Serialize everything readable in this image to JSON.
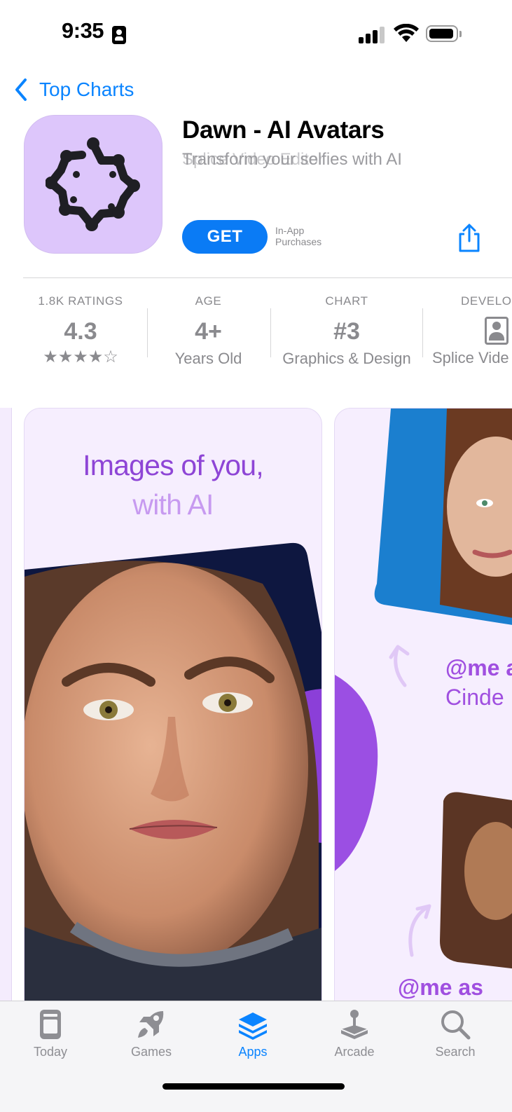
{
  "status_bar": {
    "time": "9:35"
  },
  "nav": {
    "back_label": "Top Charts"
  },
  "app": {
    "title": "Dawn - AI Avatars",
    "subtitle": "Transform your selfies with AI",
    "developer_overlap": "Splice Video Editor",
    "get_label": "GET",
    "in_app_line1": "In-App",
    "in_app_line2": "Purchases"
  },
  "info": {
    "ratings": {
      "label": "1.8K RATINGS",
      "value": "4.3",
      "stars": "★★★★☆",
      "stars_value": 4.3
    },
    "age": {
      "label": "AGE",
      "value": "4+",
      "sub": "Years Old"
    },
    "chart": {
      "label": "CHART",
      "value": "#3",
      "sub": "Graphics & Design"
    },
    "developer": {
      "label": "DEVELO",
      "sub": "Splice Vide"
    }
  },
  "screenshots": {
    "shot1": {
      "line1": "Images of you,",
      "line2": "with AI"
    },
    "shot2": {
      "promo1_a": "@me a",
      "promo1_b": "Cinde",
      "promo2": "@me as"
    }
  },
  "tabbar": {
    "tabs": [
      {
        "label": "Today",
        "icon": "today-icon",
        "active": false
      },
      {
        "label": "Games",
        "icon": "rocket-icon",
        "active": false
      },
      {
        "label": "Apps",
        "icon": "apps-stack-icon",
        "active": true
      },
      {
        "label": "Arcade",
        "icon": "joystick-icon",
        "active": false
      },
      {
        "label": "Search",
        "icon": "search-icon",
        "active": false
      }
    ]
  },
  "colors": {
    "accent": "#0a84ff",
    "icon_bg": "#ddc6fb",
    "headline_purple": "#8e45d6",
    "headline_light": "#c79af0"
  }
}
